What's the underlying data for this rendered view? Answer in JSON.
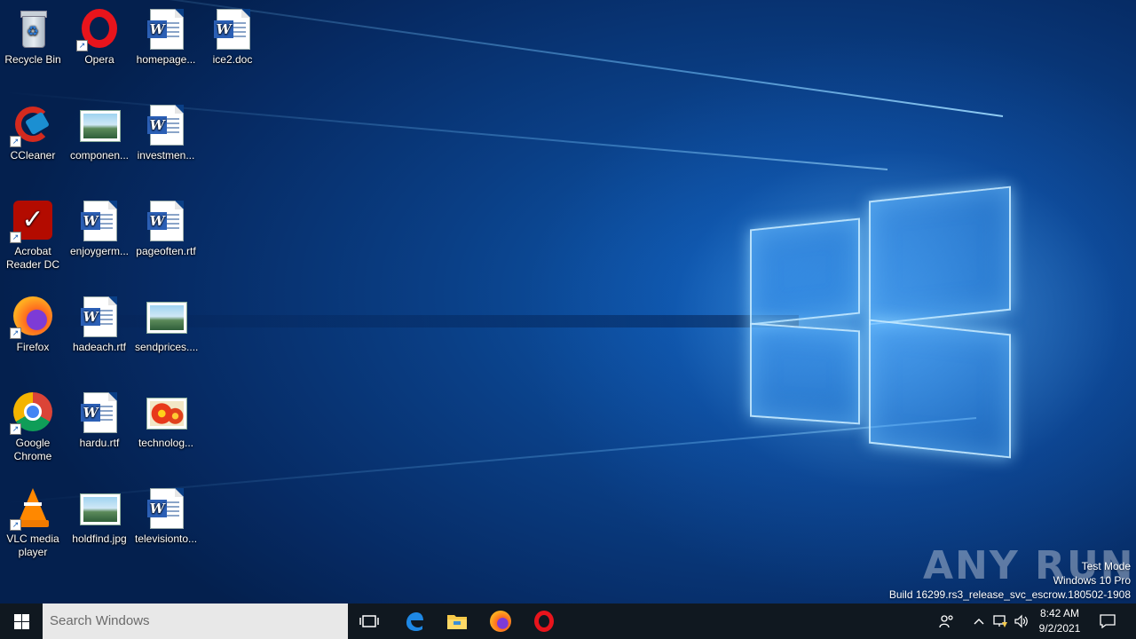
{
  "desktop": {
    "icons": [
      {
        "label": "Recycle Bin",
        "icon": "recycle-bin-icon"
      },
      {
        "label": "Opera",
        "icon": "opera-icon"
      },
      {
        "label": "homepage...",
        "icon": "word-doc-icon"
      },
      {
        "label": "ice2.doc",
        "icon": "word-doc-icon"
      },
      {
        "label": "CCleaner",
        "icon": "ccleaner-icon"
      },
      {
        "label": "componen...",
        "icon": "image-file-icon"
      },
      {
        "label": "investmen...",
        "icon": "word-doc-icon"
      },
      {
        "label": "Acrobat Reader DC",
        "icon": "acrobat-icon"
      },
      {
        "label": "enjoygerm...",
        "icon": "word-doc-icon"
      },
      {
        "label": "pageoften.rtf",
        "icon": "word-doc-icon"
      },
      {
        "label": "Firefox",
        "icon": "firefox-icon"
      },
      {
        "label": "hadeach.rtf",
        "icon": "word-doc-icon"
      },
      {
        "label": "sendprices....",
        "icon": "image-file-icon"
      },
      {
        "label": "Google Chrome",
        "icon": "chrome-icon"
      },
      {
        "label": "hardu.rtf",
        "icon": "word-doc-icon"
      },
      {
        "label": "technolog...",
        "icon": "flower-image-icon"
      },
      {
        "label": "VLC media player",
        "icon": "vlc-icon"
      },
      {
        "label": "holdfind.jpg",
        "icon": "image-file-icon"
      },
      {
        "label": "televisionto...",
        "icon": "word-doc-icon"
      }
    ]
  },
  "watermark": {
    "brand": "ANY RUN",
    "line1": "Test Mode",
    "line2": "Windows 10 Pro",
    "line3": "Build 16299.rs3_release_svc_escrow.180502-1908"
  },
  "taskbar": {
    "search_placeholder": "Search Windows",
    "pinned": [
      "task-view-icon",
      "edge-icon",
      "file-explorer-icon",
      "firefox-icon",
      "opera-icon"
    ],
    "clock_time": "8:42 AM",
    "clock_date": "9/2/2021"
  },
  "colors": {
    "taskbar": "#101820",
    "search_box": "#e8e8e8",
    "desktop_accent": "#0f5fb8"
  }
}
